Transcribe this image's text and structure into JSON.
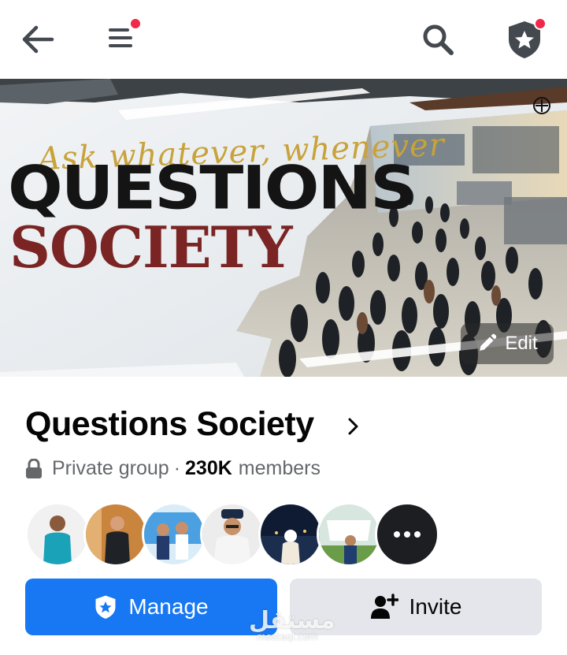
{
  "topbar": {
    "back_icon": "arrow-left-icon",
    "menu_icon": "hamburger-menu-icon",
    "search_icon": "search-icon",
    "admin_icon": "shield-star-icon",
    "notification_color": "#f02849"
  },
  "cover": {
    "tagline": "Ask whatever, whenever",
    "title_line1": "QUESTIONS",
    "title_line2": "SOCIETY",
    "edit_label": "Edit"
  },
  "group": {
    "name": "Questions Society",
    "privacy": "Private group",
    "separator": "·",
    "member_count": "230K",
    "members_label": "members"
  },
  "avatars": {
    "count_shown": 6,
    "more_icon": "more-dots-icon"
  },
  "actions": {
    "manage_label": "Manage",
    "invite_label": "Invite",
    "primary_color": "#1877f2"
  },
  "watermark": {
    "text": "مستقل",
    "sub": "mostaql.com"
  }
}
